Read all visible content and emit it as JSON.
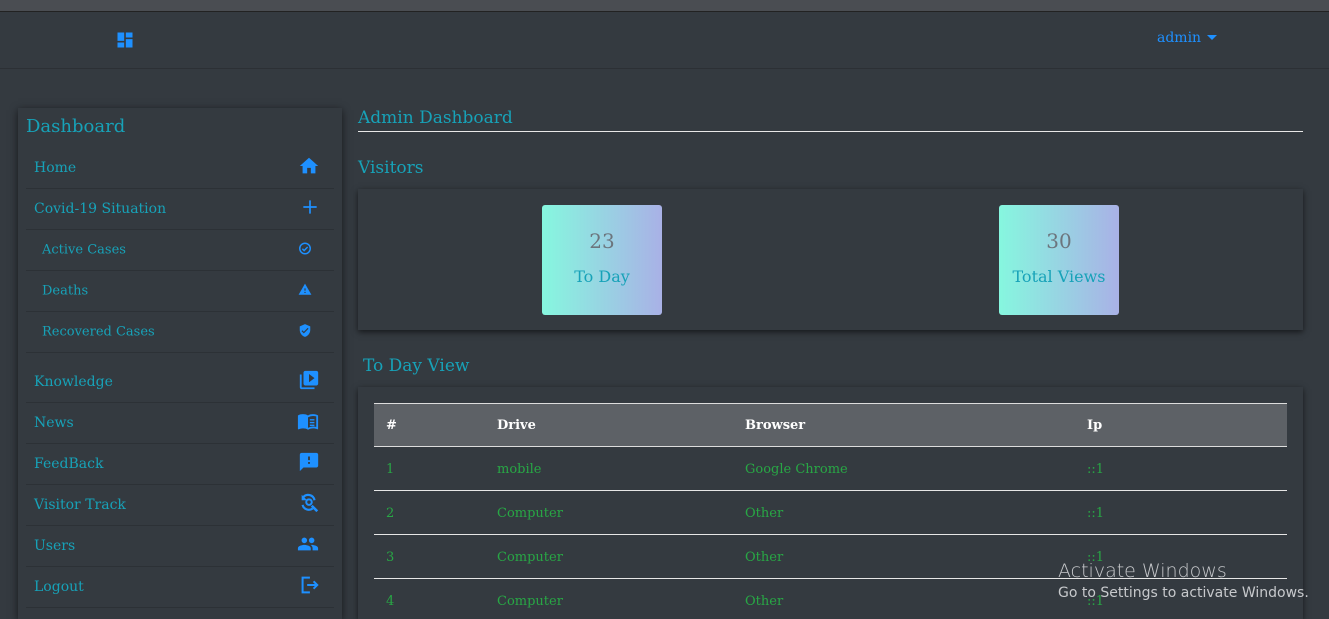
{
  "navbar": {
    "user_label": "admin"
  },
  "sidebar": {
    "title": "Dashboard",
    "items": [
      {
        "label": "Home",
        "icon": "home-icon"
      },
      {
        "label": "Covid-19 Situation",
        "icon": "plus-icon"
      },
      {
        "label": "Active Cases",
        "icon": "check-circle-icon"
      },
      {
        "label": "Deaths",
        "icon": "warning-icon"
      },
      {
        "label": "Recovered Cases",
        "icon": "shield-check-icon"
      },
      {
        "label": "Knowledge",
        "icon": "video-library-icon"
      },
      {
        "label": "News",
        "icon": "book-open-icon"
      },
      {
        "label": "FeedBack",
        "icon": "feedback-icon"
      },
      {
        "label": "Visitor Track",
        "icon": "search-refresh-icon"
      },
      {
        "label": "Users",
        "icon": "users-icon"
      },
      {
        "label": "Logout",
        "icon": "logout-icon"
      }
    ]
  },
  "main": {
    "page_title": "Admin Dashboard",
    "visitors_title": "Visitors",
    "stats": [
      {
        "value": "23",
        "label": "To Day"
      },
      {
        "value": "30",
        "label": "Total Views"
      }
    ],
    "today_view_title": "To Day View",
    "table": {
      "headers": [
        "#",
        "Drive",
        "Browser",
        "Ip"
      ],
      "rows": [
        [
          "1",
          "mobile",
          "Google Chrome",
          "::1"
        ],
        [
          "2",
          "Computer",
          "Other",
          "::1"
        ],
        [
          "3",
          "Computer",
          "Other",
          "::1"
        ],
        [
          "4",
          "Computer",
          "Other",
          "::1"
        ]
      ]
    }
  },
  "watermark": {
    "title": "Activate Windows",
    "subtitle": "Go to Settings to activate Windows."
  },
  "colors": {
    "accent": "#17a2b8",
    "link": "#1e90ff",
    "row_text": "#28a745",
    "background": "#343a40"
  }
}
